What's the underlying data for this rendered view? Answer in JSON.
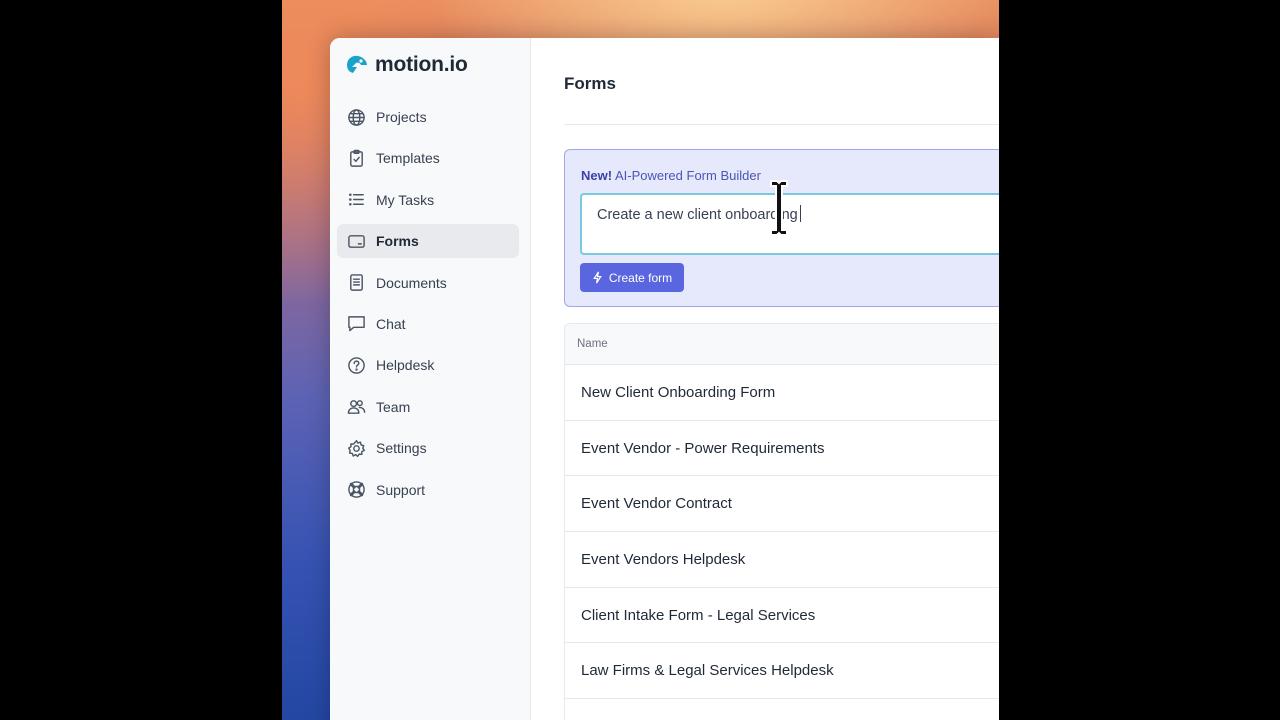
{
  "app": {
    "logo_text": "motion.io"
  },
  "sidebar": {
    "items": [
      {
        "label": "Projects",
        "icon": "globe-icon",
        "active": false
      },
      {
        "label": "Templates",
        "icon": "clipboard-check-icon",
        "active": false
      },
      {
        "label": "My Tasks",
        "icon": "list-icon",
        "active": false
      },
      {
        "label": "Forms",
        "icon": "form-icon",
        "active": true
      },
      {
        "label": "Documents",
        "icon": "document-icon",
        "active": false
      },
      {
        "label": "Chat",
        "icon": "chat-icon",
        "active": false
      },
      {
        "label": "Helpdesk",
        "icon": "question-circle-icon",
        "active": false
      },
      {
        "label": "Team",
        "icon": "users-icon",
        "active": false
      },
      {
        "label": "Settings",
        "icon": "gear-icon",
        "active": false
      },
      {
        "label": "Support",
        "icon": "lifebuoy-icon",
        "active": false
      }
    ]
  },
  "main": {
    "title": "Forms",
    "ai_builder": {
      "new_label": "New!",
      "label": "AI-Powered Form Builder",
      "input_value": "Create a new client onboarding",
      "button_label": "Create form"
    },
    "table": {
      "header": "Name",
      "rows": [
        "New Client Onboarding Form",
        "Event Vendor - Power Requirements",
        "Event Vendor Contract",
        "Event Vendors Helpdesk",
        "Client Intake Form - Legal Services",
        "Law Firms & Legal Services Helpdesk"
      ]
    }
  },
  "colors": {
    "accent": "#5a66e0",
    "ai_box_bg": "#e6e8fb",
    "input_focus": "#79c9e2",
    "logo": "#1aa3c8"
  }
}
